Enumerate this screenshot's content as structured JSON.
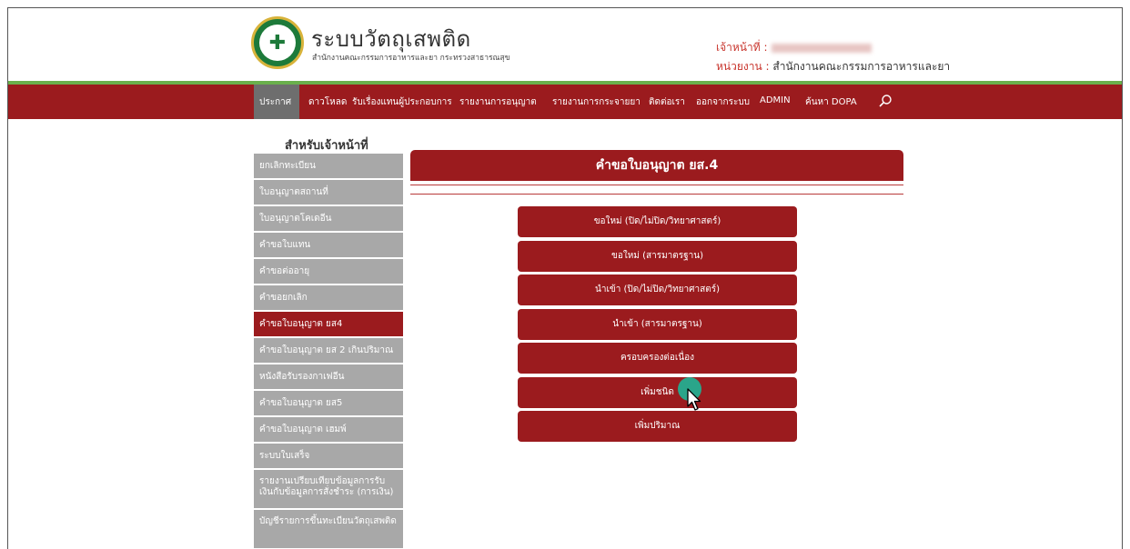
{
  "header": {
    "title": "ระบบวัตถุเสพติด",
    "subtitle": "สำนักงานคณะกรรมการอาหารและยา กระทรวงสาธารณสุข",
    "officer_label": "เจ้าหน้าที่ :",
    "unit_label": "หน่วยงาน :",
    "unit_value": "สำนักงานคณะกรรมการอาหารและยา",
    "logo_icon": "ministry-of-public-health-seal-icon"
  },
  "nav": {
    "items": [
      "ประกาศ",
      "ดาวโหลด",
      "รับเรื่องแทนผู้ประกอบการ",
      "รายงานการอนุญาต",
      "รายงานการกระจายยา",
      "ติดต่อเรา",
      "ออกจากระบบ",
      "ADMIN",
      "ค้นหา DOPA"
    ],
    "search_icon": "search-icon"
  },
  "sidebar": {
    "title": "สำหรับเจ้าหน้าที่",
    "items": [
      "ยกเลิกทะเบียน",
      "ใบอนุญาตสถานที่",
      "ใบอนุญาตโคเดอีน",
      "คำขอใบแทน",
      "คำขอต่ออายุ",
      "คำขอยกเลิก",
      "คำขอใบอนุญาต ยส4",
      "คำขอใบอนุญาต ยส 2 เกินปริมาณ",
      "หนังสือรับรองกาเฟอีน",
      "คำขอใบอนุญาต ยส5",
      "คำขอใบอนุญาต เฮมพ์",
      "ระบบใบเสร็จ",
      "รายงานเปรียบเทียบข้อมูลการรับเงินกับข้อมูลการสั่งชำระ (การเงิน)",
      "บัญชีรายการขึ้นทะเบียนวัตถุเสพติด"
    ],
    "active_index": 6
  },
  "main": {
    "title": "คำขอใบอนุญาต ยส.4",
    "actions": [
      "ขอใหม่ (ปิด/ไม่ปิด/วิทยาศาสตร์)",
      "ขอใหม่ (สารมาตรฐาน)",
      "นำเข้า (ปิด/ไม่ปิด/วิทยาศาสตร์)",
      "นำเข้า (สารมาตรฐาน)",
      "ครอบครองต่อเนื่อง",
      "เพิ่มชนิด",
      "เพิ่มปริมาณ"
    ]
  },
  "colors": {
    "brand_red": "#9b1b1e",
    "accent_green": "#6ab04c",
    "sidebar_gray": "#a8a8a8",
    "click_indicator": "#2aa58a"
  }
}
